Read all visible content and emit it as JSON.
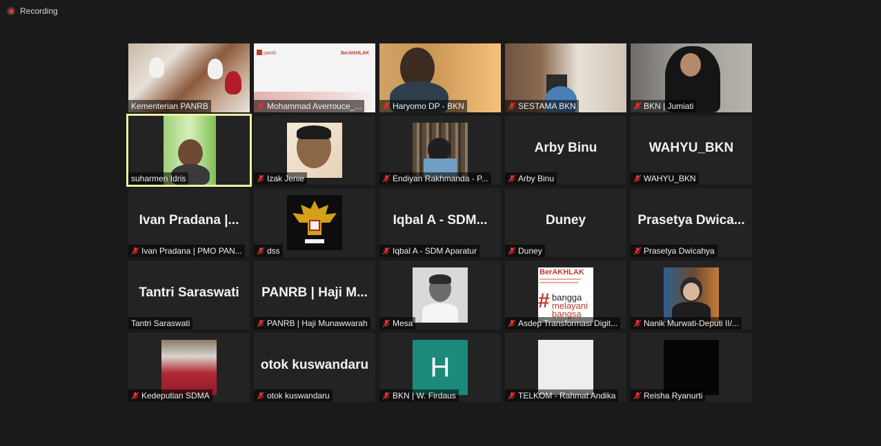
{
  "recording_label": "Recording",
  "tiles": [
    {
      "name": "Kementerian PANRB",
      "muted": false
    },
    {
      "name": "Mohammad Averrouce_...",
      "muted": true
    },
    {
      "name": "Haryomo DP - BKN",
      "muted": true
    },
    {
      "name": "SESTAMA BKN",
      "muted": true
    },
    {
      "name": "BKN | Jumiati",
      "muted": true
    },
    {
      "name": "suharmen Idris",
      "muted": false
    },
    {
      "name": "Izak Jenie",
      "muted": true
    },
    {
      "name": "Endiyan Rakhmanda - P...",
      "muted": true
    },
    {
      "name": "Arby Binu",
      "muted": true,
      "display": "Arby Binu"
    },
    {
      "name": "WAHYU_BKN",
      "muted": true,
      "display": "WAHYU_BKN"
    },
    {
      "name": "Ivan Pradana | PMO PAN...",
      "muted": true,
      "display": "Ivan Pradana |..."
    },
    {
      "name": "dss",
      "muted": true
    },
    {
      "name": "Iqbal A - SDM Aparatur",
      "muted": true,
      "display": "Iqbal A - SDM..."
    },
    {
      "name": "Duney",
      "muted": true,
      "display": "Duney"
    },
    {
      "name": "Prasetya Dwicahya",
      "muted": true,
      "display": "Prasetya Dwica..."
    },
    {
      "name": "Tantri Saraswati",
      "muted": false,
      "display": "Tantri Saraswati"
    },
    {
      "name": "PANRB | Haji Munawwarah",
      "muted": true,
      "display": "PANRB | Haji M..."
    },
    {
      "name": "Mesa",
      "muted": true
    },
    {
      "name": "Asdep Transformasi Digit...",
      "muted": true
    },
    {
      "name": "Nanik Murwati-Deputi II/...",
      "muted": true
    },
    {
      "name": "Kedeputian SDMA",
      "muted": true
    },
    {
      "name": "otok kuswandaru",
      "muted": true,
      "display": "otok kuswandaru"
    },
    {
      "name": "BKN | W. Firdaus",
      "muted": true
    },
    {
      "name": "TELKOM - Rahmat Andika",
      "muted": true
    },
    {
      "name": "Reisha Ryanurti",
      "muted": true
    }
  ],
  "slide": {
    "logo": "panrb",
    "brand": "BerAKHLAK"
  },
  "avatar_text": {
    "firdaus_letter": "H",
    "berakhlak_title": "BerAKHLAK",
    "berakhlak_line1": "bangga",
    "berakhlak_line2": "melayani",
    "berakhlak_line3": "bangsa",
    "berakhlak_hash": "#"
  },
  "colors": {
    "active_outline": "#f1f0a0",
    "muted_icon": "#e8312f",
    "firdaus_bg": "#1b8a7a"
  }
}
